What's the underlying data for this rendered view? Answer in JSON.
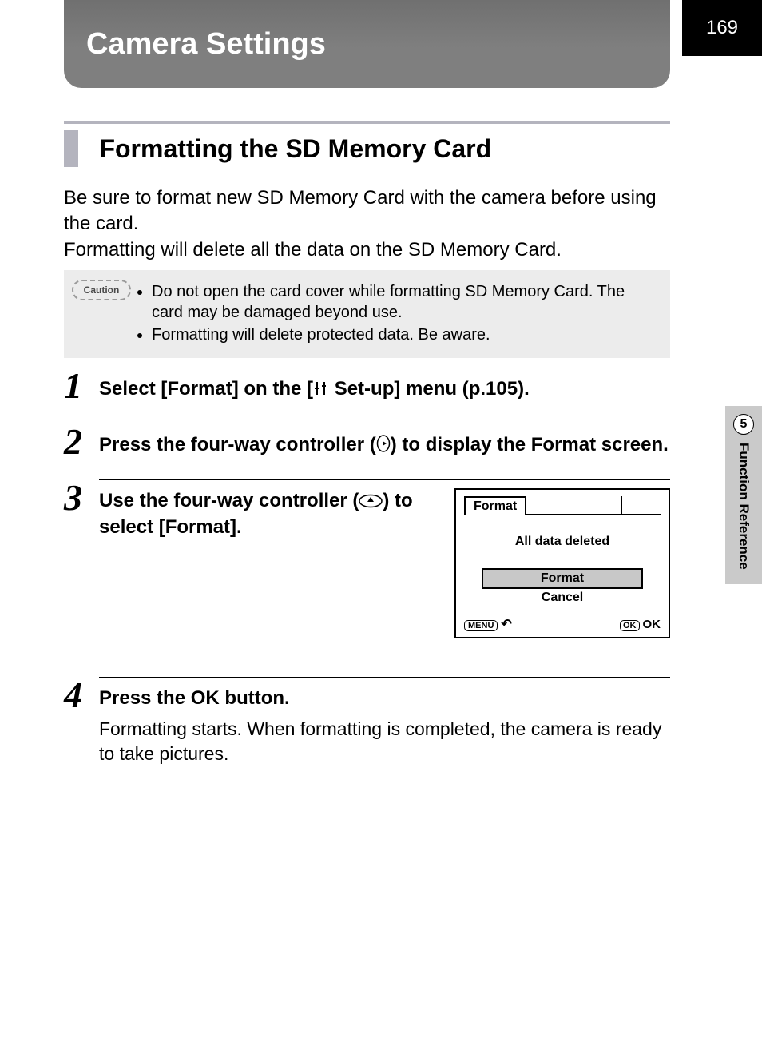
{
  "page_number": "169",
  "header_title": "Camera Settings",
  "section_title": "Formatting the SD Memory Card",
  "intro_line1": "Be sure to format new SD Memory Card with the camera before using the card.",
  "intro_line2": "Formatting will delete all the data on the SD Memory Card.",
  "caution_label": "Caution",
  "caution_items": [
    "Do not open the card cover while formatting SD Memory Card. The card may be damaged beyond use.",
    "Formatting will delete protected data. Be aware."
  ],
  "steps": {
    "s1": {
      "num": "1",
      "title_pre": "Select [Format] on the [",
      "setup_icon_text": "Set-up",
      "title_post": "] menu (p.105)."
    },
    "s2": {
      "num": "2",
      "title_pre": "Press the four-way controller (",
      "arrow_label": "▶",
      "title_post": ") to display the Format screen."
    },
    "s3": {
      "num": "3",
      "title_pre": "Use the four-way controller (",
      "arrow_label": "▲",
      "title_post": ") to select [Format]."
    },
    "s4": {
      "num": "4",
      "title_pre": "Press the ",
      "ok_label": "OK",
      "title_post": " button.",
      "desc": "Formatting starts. When formatting is completed, the camera is ready to take pictures."
    }
  },
  "format_screen": {
    "tab": "Format",
    "message": "All data deleted",
    "option_format": "Format",
    "option_cancel": "Cancel",
    "menu_btn": "MENU",
    "ok_btn": "OK",
    "ok_text": "OK"
  },
  "side_tab": {
    "number": "5",
    "label": "Function Reference"
  }
}
